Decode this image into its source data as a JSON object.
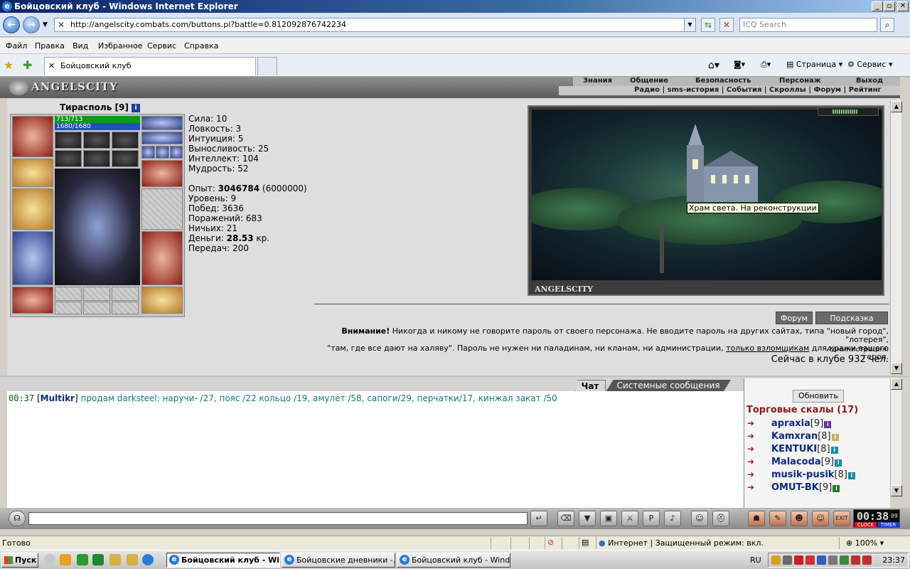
{
  "window": {
    "title": "Бойцовский клуб - Windows Internet Explorer"
  },
  "browser": {
    "url": "http://angelscity.combats.com/buttons.pl?battle=0.812092876742234",
    "search_placeholder": "ICQ Search",
    "menu": [
      "Файл",
      "Правка",
      "Вид",
      "Избранное",
      "Сервис",
      "Справка"
    ],
    "tab_title": "Бойцовский клуб",
    "tools": {
      "page": "Страница",
      "service": "Сервис"
    }
  },
  "game": {
    "logo": "ANGELSCITY",
    "top_menu": [
      "Знания",
      "Общение",
      "Безопасность",
      "Персонаж",
      "Выход"
    ],
    "sub_menu": "Радио | sms-история | События | Скроллы | Форум | Рейтинг",
    "character": {
      "name": "Тирасполь",
      "level": "[9]",
      "info_icon": "i",
      "hp": "713/713",
      "mp": "1680/1680",
      "hp_fraction": 1.0,
      "mp_fraction": 1.0
    },
    "stats": {
      "strength": "Сила: 10",
      "agility": "Ловкость: 3",
      "intuition": "Интуиция: 5",
      "endurance": "Выносливость: 25",
      "intellect": "Интеллект: 104",
      "wisdom": "Мудрость: 52"
    },
    "info": {
      "exp_label": "Опыт: ",
      "exp_value": "3046784",
      "exp_next": " (6000000)",
      "level": "Уровень: 9",
      "wins": "Побед: 3636",
      "losses": "Поражений: 683",
      "draws": "Ничьих: 21",
      "money_label": "Деньги: ",
      "money_value": "28.53",
      "money_unit": " кр.",
      "transfers": "Передач: 200"
    },
    "map": {
      "label": "ANGELSCITY",
      "tooltip": "Храм света. На реконструкции"
    },
    "buttons": {
      "forum": "Форум",
      "hint": "Подсказка"
    },
    "warning": {
      "bold": "Внимание!",
      "line1": " Никогда и никому не говорите пароль от своего персонажа. Не вводите пароль на других сайтах, типа \"новый город\", \"лотерея\",",
      "line2_pre": "\"там, где все дают на халяву\". Пароль не нужен ни паладинам, ни кланам, ни администрации, ",
      "line2_link": "только взломщикам",
      "line2_post": " для кражи вашего героя.",
      "admin": "Администрация."
    },
    "online": "Сейчас в клубе 932 чел."
  },
  "chat": {
    "tabs": [
      "Чат",
      "Системные сообщения"
    ],
    "messages": [
      {
        "time": "00:37",
        "nick": "Multikr",
        "text": " продам darksteel: наручи- /27, пояс /22 кольцо /19, амулет /58, сапоги/29, перчатки/17, кинжал закат /50"
      }
    ],
    "refresh": "Обновить",
    "room": "Торговые скалы (17)",
    "users": [
      {
        "name": "apraxia",
        "level": "[9]",
        "badge_color": "#6a2aa0"
      },
      {
        "name": "Kamxran",
        "level": "[8]",
        "badge_color": "#c8b060"
      },
      {
        "name": "KENTUKI",
        "level": "[8]",
        "badge_color": "#1a8aa8"
      },
      {
        "name": "Malacoda",
        "level": "[9]",
        "badge_color": "#1a8aa8"
      },
      {
        "name": "musik-pusik",
        "level": "[8]",
        "badge_color": "#1a8aa8"
      },
      {
        "name": "OMUT-BK",
        "level": "[9]",
        "badge_color": "#1a7a2a"
      }
    ],
    "clock": {
      "time": "00:38",
      "seconds": "09",
      "clock_label": "CLOCK",
      "timer_label": "TIMER"
    }
  },
  "statusbar": {
    "status": "Готово",
    "zone": "Интернет | Защищенный режим: вкл.",
    "zoom": "100%"
  },
  "taskbar": {
    "start": "Пуск",
    "tasks": [
      "Бойцовский клуб - Wi...",
      "Бойцовские дневники -...",
      "Бойцовский клуб - Wind..."
    ],
    "lang": "RU",
    "time": "23:37"
  }
}
